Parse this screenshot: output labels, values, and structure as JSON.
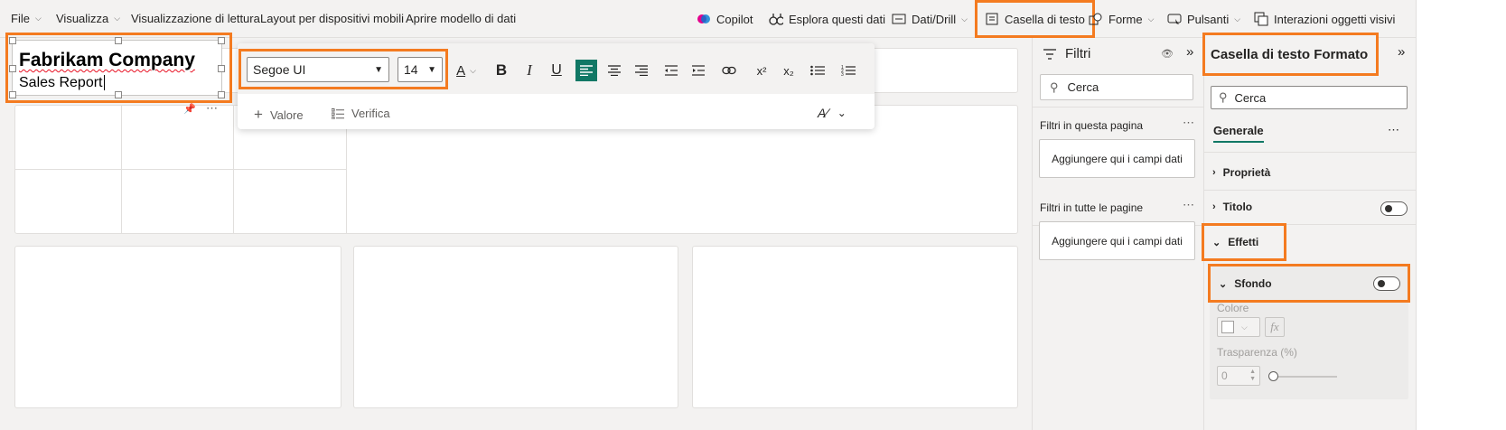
{
  "ribbon": {
    "menus": [
      "File",
      "Visualizza",
      "Visualizzazione di lettura",
      "Layout per dispositivi mobili",
      "Aprire modello di dati"
    ],
    "actions": {
      "copilot": "Copilot",
      "explore": "Esplora questi dati",
      "drill": "Dati/Drill",
      "textbox": "Casella di testo",
      "shapes": "Forme",
      "buttons": "Pulsanti",
      "interactions": "Interazioni oggetti visivi"
    }
  },
  "textbox": {
    "line1": "Fabrikam Company",
    "line2": "Sales Report"
  },
  "format_bar": {
    "font": "Segoe UI",
    "size": "14",
    "value_label": "Valore",
    "review_label": "Verifica",
    "superscript": "x²",
    "subscript": "x₂"
  },
  "filters": {
    "title": "Filtri",
    "search_placeholder": "Cerca",
    "this_page": "Filtri in questa pagina",
    "all_pages": "Filtri in tutte le pagine",
    "drop_label": "Aggiungere qui i campi dati"
  },
  "format_pane": {
    "title": "Casella di testo Formato",
    "search_placeholder": "Cerca",
    "tab_general": "Generale",
    "properties": "Proprietà",
    "title_section": "Titolo",
    "effects": "Effetti",
    "background": "Sfondo",
    "color_label": "Colore",
    "fx": "fx",
    "transparency_label": "Trasparenza (%)",
    "transparency_value": "0"
  },
  "colors": {
    "accent": "#f47b20",
    "align_active": "#117865"
  }
}
